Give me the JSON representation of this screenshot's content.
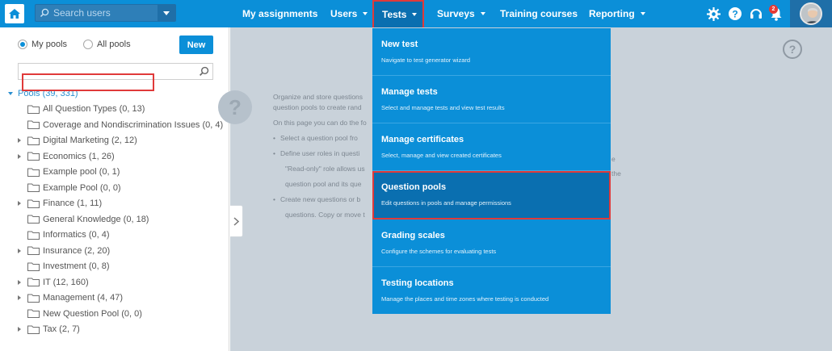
{
  "header": {
    "search": {
      "placeholder": "Search users"
    },
    "nav": [
      {
        "label": "My assignments"
      },
      {
        "label": "Users"
      },
      {
        "label": "Tests"
      },
      {
        "label": "Surveys"
      },
      {
        "label": "Training courses"
      },
      {
        "label": "Reporting"
      }
    ],
    "notification_count": "2",
    "icons": [
      "home-icon",
      "search-icon",
      "chevron-down-icon",
      "gear-icon",
      "help-icon",
      "headset-icon",
      "bell-icon",
      "avatar"
    ],
    "colors": {
      "bar": "#0b8fd8",
      "active_nav": "#0a6fb0",
      "highlight": "#e03a3a"
    }
  },
  "pools_panel": {
    "filter_options": [
      {
        "label": "My pools",
        "selected": true
      },
      {
        "label": "All pools",
        "selected": false
      }
    ],
    "new_button": "New",
    "tree_root": "Pools (39, 331)",
    "items": [
      {
        "label": "All Question Types (0, 13)",
        "expandable": false
      },
      {
        "label": "Coverage and Nondiscrimination Issues (0, 4)",
        "expandable": false
      },
      {
        "label": "Digital Marketing (2, 12)",
        "expandable": true
      },
      {
        "label": "Economics (1, 26)",
        "expandable": true
      },
      {
        "label": "Example pool (0, 1)",
        "expandable": false
      },
      {
        "label": "Example Pool (0, 0)",
        "expandable": false
      },
      {
        "label": "Finance (1, 11)",
        "expandable": true
      },
      {
        "label": "General Knowledge (0, 18)",
        "expandable": false
      },
      {
        "label": "Informatics (0, 4)",
        "expandable": false
      },
      {
        "label": "Insurance (2, 20)",
        "expandable": true
      },
      {
        "label": "Investment (0, 8)",
        "expandable": false
      },
      {
        "label": "IT (12, 160)",
        "expandable": true
      },
      {
        "label": "Management (4, 47)",
        "expandable": true
      },
      {
        "label": "New Question Pool (0, 0)",
        "expandable": false
      },
      {
        "label": "Tax (2, 7)",
        "expandable": true
      }
    ]
  },
  "main": {
    "intro_line1": "Organize and store questions",
    "intro_line2": "question pools to create rand",
    "intro_line3": "On this page you can do the fo",
    "bullets": [
      "Select a question pool fro",
      "Define user roles in questi",
      "Create new questions or b"
    ],
    "bullet2_cont": [
      "\"Read-only\" role allows us",
      "question pool and its que"
    ],
    "bullet3_cont": [
      "questions. Copy or move t"
    ],
    "tail_e": "e",
    "tail_the": "the"
  },
  "tests_menu": [
    {
      "title": "New test",
      "subtitle": "Navigate to test generator wizard"
    },
    {
      "title": "Manage tests",
      "subtitle": "Select and manage tests and view test results"
    },
    {
      "title": "Manage certificates",
      "subtitle": "Select, manage and view created certificates"
    },
    {
      "title": "Question pools",
      "subtitle": "Edit questions in pools and manage permissions"
    },
    {
      "title": "Grading scales",
      "subtitle": "Configure the schemes for evaluating tests"
    },
    {
      "title": "Testing locations",
      "subtitle": "Manage the places and time zones where testing is conducted"
    }
  ]
}
